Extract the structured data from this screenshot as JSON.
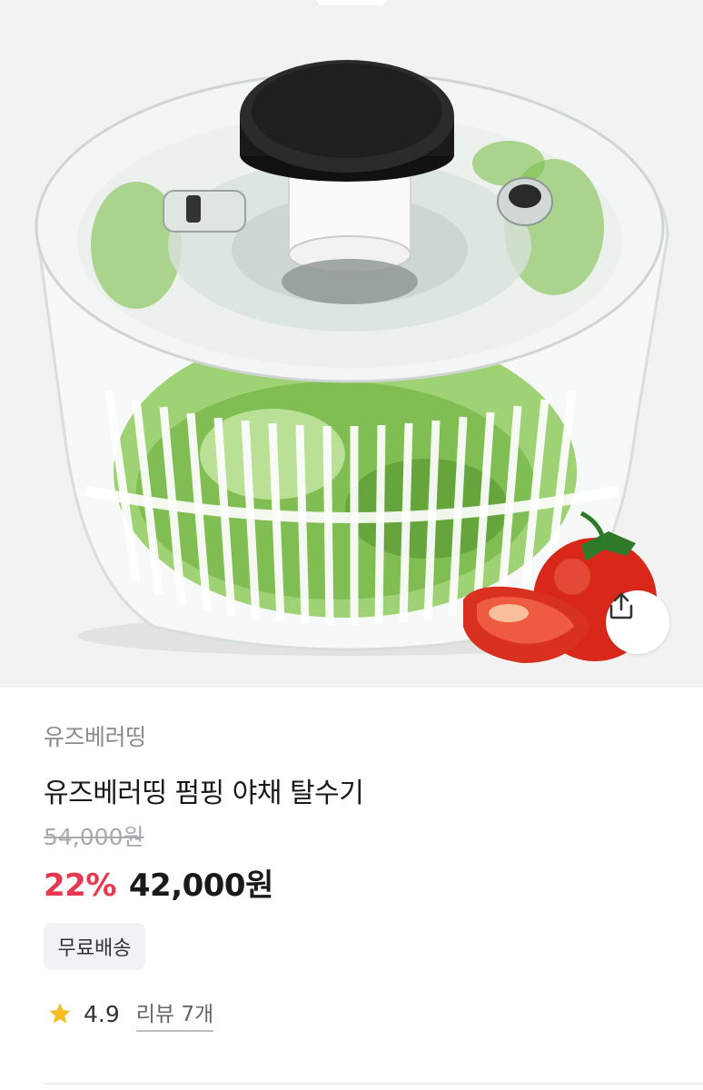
{
  "product": {
    "brand": "유즈베러띵",
    "title": "유즈베러띵 펌핑 야채 탈수기",
    "original_price": "54,000원",
    "discount_rate": "22%",
    "sale_price": "42,000원",
    "badge": "무료배송",
    "rating": "4.9",
    "review_link": "리뷰 7개"
  },
  "icons": {
    "share": "share-icon",
    "star": "star-icon"
  },
  "colors": {
    "discount": "#e8384f",
    "star": "#f6bf26",
    "image_background": "#f2f2f2"
  }
}
